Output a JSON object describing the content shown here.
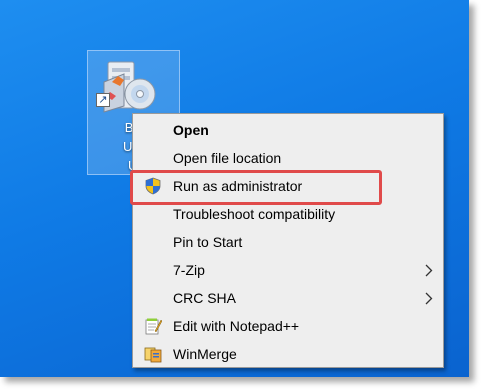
{
  "desktop_icon": {
    "label_lines": [
      "BM",
      "Upc",
      "Ut"
    ]
  },
  "menu": {
    "items": [
      {
        "label": "Open"
      },
      {
        "label": "Open file location"
      },
      {
        "label": "Run as administrator"
      },
      {
        "label": "Troubleshoot compatibility"
      },
      {
        "label": "Pin to Start"
      },
      {
        "label": "7-Zip"
      },
      {
        "label": "CRC SHA"
      },
      {
        "label": "Edit with Notepad++"
      },
      {
        "label": "WinMerge"
      }
    ]
  },
  "colors": {
    "desktop": "#0f7ae5",
    "menu_background": "#eeeeee",
    "highlight_border": "#e04a4a"
  },
  "icons": [
    "installer-app-icon",
    "shortcut-arrow-icon",
    "uac-shield-icon",
    "chevron-right-icon",
    "notepad-plus-plus-icon",
    "winmerge-icon"
  ]
}
